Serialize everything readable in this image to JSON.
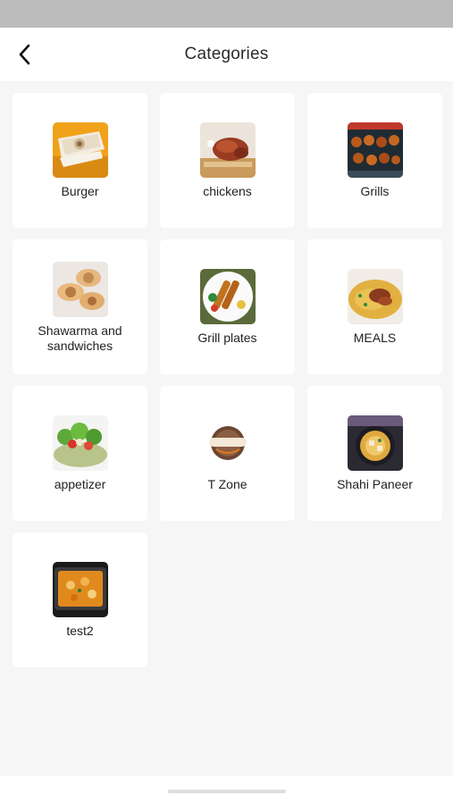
{
  "header": {
    "title": "Categories",
    "back_icon": "chevron-left-icon"
  },
  "categories": [
    {
      "label": "Burger",
      "image": "wrap-roll-photo"
    },
    {
      "label": "chickens",
      "image": "roast-chicken-photo"
    },
    {
      "label": "Grills",
      "image": "grill-skewers-photo"
    },
    {
      "label": "Shawarma and sandwiches",
      "image": "shawarma-rolls-photo"
    },
    {
      "label": "Grill plates",
      "image": "grill-plate-photo"
    },
    {
      "label": "MEALS",
      "image": "rice-meal-photo"
    },
    {
      "label": "appetizer",
      "image": "salad-photo"
    },
    {
      "label": "T Zone",
      "image": "logo-badge"
    },
    {
      "label": "Shahi Paneer",
      "image": "curry-bowl-photo"
    },
    {
      "label": "test2",
      "image": "curry-dish-photo"
    }
  ],
  "colors": {
    "background": "#f6f6f6",
    "card": "#ffffff",
    "status_bar": "#bcbcbc"
  }
}
